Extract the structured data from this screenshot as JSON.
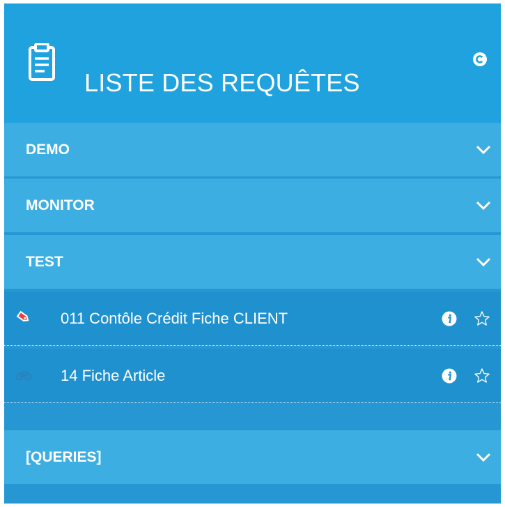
{
  "header": {
    "title": "LISTE DES REQUÊTES",
    "icon": "clipboard-icon",
    "refresh_icon": "copyright-refresh-icon"
  },
  "groups": [
    {
      "label": "DEMO",
      "expanded": false
    },
    {
      "label": "MONITOR",
      "expanded": false
    },
    {
      "label": "TEST",
      "expanded": true,
      "items": [
        {
          "label": "011 Contôle Crédit Fiche CLIENT",
          "icon": "tag-icon",
          "icon_color": "#e8433a"
        },
        {
          "label": "14 Fiche Article",
          "icon": "bicycle-icon",
          "icon_color": "#2a82c0"
        }
      ]
    },
    {
      "label": "[QUERIES]",
      "expanded": false
    }
  ],
  "colors": {
    "header_bg": "#1fa2de",
    "group_bg": "#3daee1",
    "item_bg": "#2091cf",
    "panel_bg": "#2797d4",
    "text": "#ffffff"
  }
}
